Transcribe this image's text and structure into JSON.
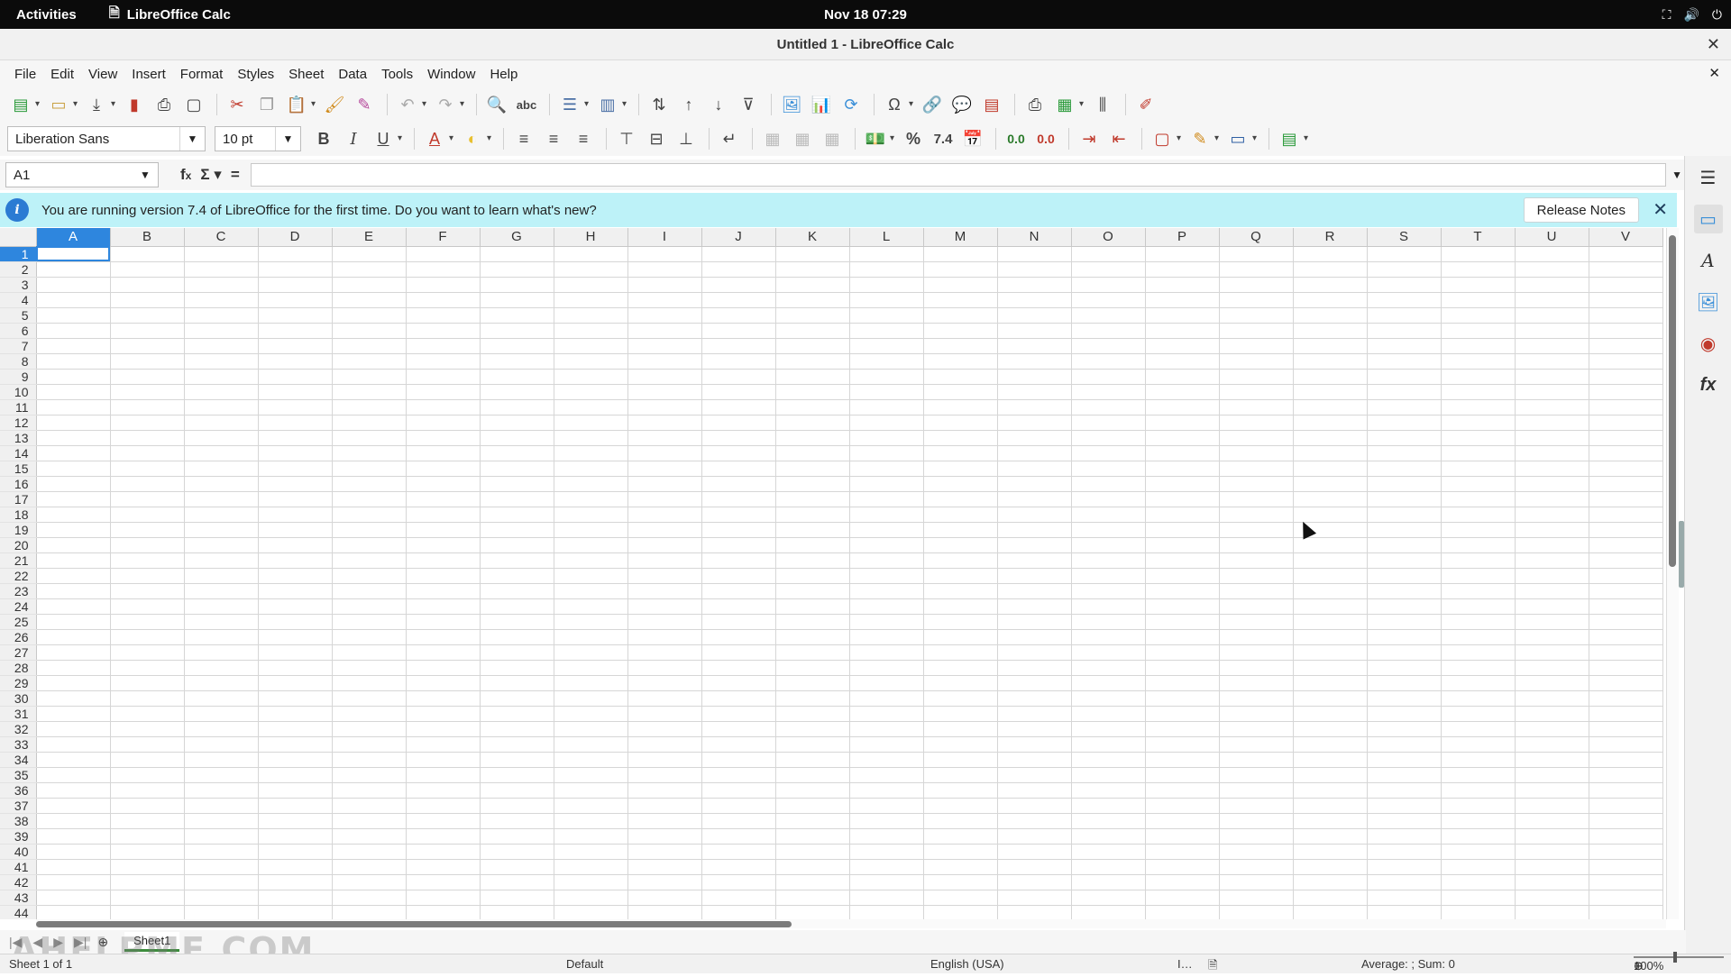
{
  "topbar": {
    "activities": "Activities",
    "app_name": "LibreOffice Calc",
    "clock": "Nov 18  07:29",
    "icons": [
      "network-icon",
      "volume-icon",
      "power-icon"
    ]
  },
  "window": {
    "title": "Untitled 1 - LibreOffice Calc"
  },
  "menubar": {
    "items": [
      "File",
      "Edit",
      "View",
      "Insert",
      "Format",
      "Styles",
      "Sheet",
      "Data",
      "Tools",
      "Window",
      "Help"
    ]
  },
  "formatting": {
    "font_name": "Liberation Sans",
    "font_size": "10 pt",
    "number_percent": "%",
    "number_decimal": "7.4",
    "add_decimal": "0.0",
    "remove_decimal": "0.0"
  },
  "formula_bar": {
    "name_box": "A1",
    "formula_value": ""
  },
  "infobar": {
    "message": "You are running version 7.4 of LibreOffice for the first time. Do you want to learn what's new?",
    "button": "Release Notes"
  },
  "grid": {
    "columns": [
      "A",
      "B",
      "C",
      "D",
      "E",
      "F",
      "G",
      "H",
      "I",
      "J",
      "K",
      "L",
      "M",
      "N",
      "O",
      "P",
      "Q",
      "R",
      "S",
      "T",
      "U",
      "V"
    ],
    "row_count": 44,
    "active_cell": "A1"
  },
  "sheet_tabs": {
    "tabs": [
      "Sheet1"
    ]
  },
  "statusbar": {
    "sheet_info": "Sheet 1 of 1",
    "page_style": "Default",
    "language": "English (USA)",
    "summary": "Average: ; Sum: 0",
    "zoom": "100%"
  },
  "watermark": "AHELPME.COM",
  "colors": {
    "selection": "#2e86de",
    "infobar": "#bdf2f8",
    "sheet_tab_accent": "#3c8c3c"
  }
}
